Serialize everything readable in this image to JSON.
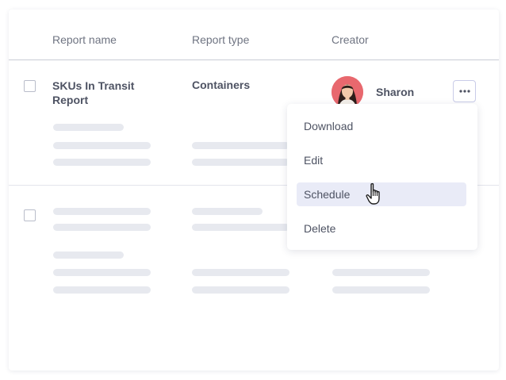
{
  "table": {
    "columns": [
      "Report name",
      "Report type",
      "Creator"
    ],
    "rows": [
      {
        "report_name": "SKUs In Transit Report",
        "report_type": "Containers",
        "creator": "Sharon"
      }
    ]
  },
  "row_actions": {
    "more_icon": "more-horizontal-icon",
    "menu_items": [
      "Download",
      "Edit",
      "Schedule",
      "Delete"
    ],
    "highlighted_item": "Schedule"
  },
  "colors": {
    "text": "#4e5363",
    "header_text": "#6f7482",
    "skeleton": "#e7e9ef",
    "menu_highlight": "#e9ebf7",
    "avatar_bg": "#e8686e"
  }
}
